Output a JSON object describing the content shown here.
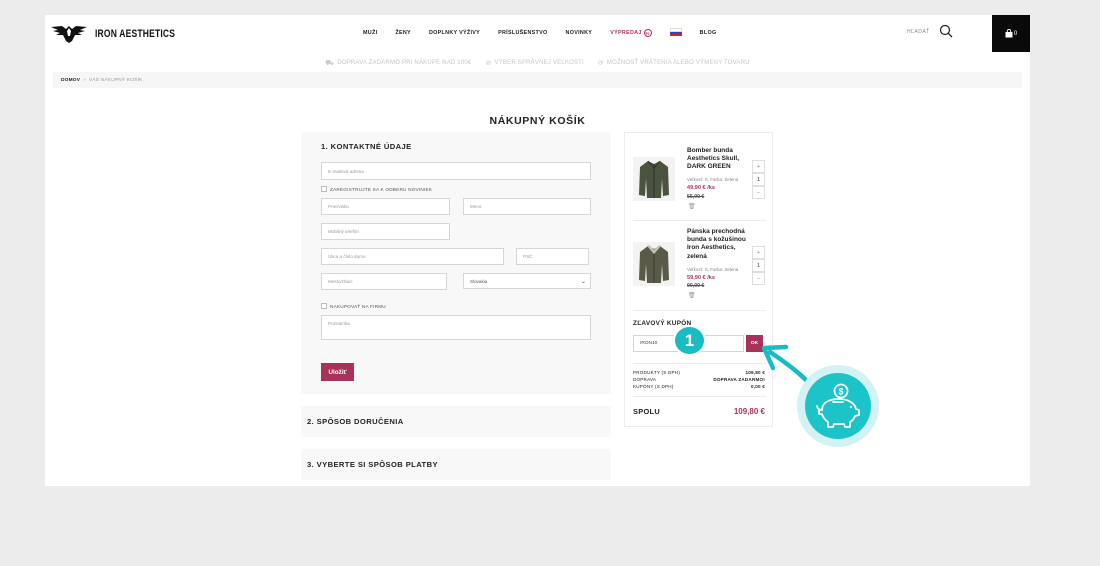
{
  "header": {
    "logo_text": "IRON AESTHETICS",
    "nav": [
      {
        "label": "MUŽI"
      },
      {
        "label": "ŽENY"
      },
      {
        "label": "DOPLNKY VÝŽIVY"
      },
      {
        "label": "PRÍSLUŠENSTVO"
      },
      {
        "label": "NOVINKY"
      },
      {
        "label": "VÝPREDAJ",
        "badge": "%",
        "color": "#b03358"
      }
    ],
    "blog_label": "BLOG",
    "search_label": "HĽADAŤ",
    "cart_count": "0"
  },
  "usp": [
    {
      "icon": "truck-icon",
      "text": "DOPRAVA ZADARMO PRI NÁKUPE NAD 100€"
    },
    {
      "icon": "ruler-icon",
      "text": "VÝBER SPRÁVNEJ VEĽKOSTI"
    },
    {
      "icon": "return-icon",
      "text": "MOŽNOSŤ VRÁTENIA ALEBO VÝMENY TOVARU"
    }
  ],
  "breadcrumb": {
    "home": "DOMOV",
    "sep": "»",
    "current": "VÁŠ NÁKUPNÝ KOŠÍK"
  },
  "page_title": "NÁKUPNÝ KOŠÍK",
  "contact_form": {
    "title": "1. KONTAKTNÉ ÚDAJE",
    "email_placeholder": "E-mailová adresa",
    "newsletter_label": "ZAREGISTRUJTE SA K ODBERU NOVINIEK",
    "surname_placeholder": "Priezvisko",
    "name_placeholder": "Meno",
    "phone_placeholder": "Mobilný telefón",
    "street_placeholder": "Ulica a číslo domu",
    "zip_placeholder": "PSČ",
    "city_placeholder": "Mesto/Obec",
    "country_value": "Slovakia",
    "company_label": "NAKUPOVAŤ NA FIRMU",
    "note_placeholder": "Poznámka",
    "save_label": "Uložiť"
  },
  "steps": {
    "delivery": "2. SPÔSOB DORUČENIA",
    "payment": "3. VYBERTE SI SPÔSOB PLATBY"
  },
  "cart": {
    "items": [
      {
        "name": "Bomber bunda Aesthetics Skull, DARK GREEN",
        "meta": "Veľkosť: S, Farba: Zelená",
        "price": "49,90 € /ks",
        "old_price": "55,00 €",
        "qty": "1"
      },
      {
        "name": "Pánska prechodná bunda s kožušinou Iron Aesthetics, zelená",
        "meta": "Veľkosť: S, Farba: Zelená",
        "price": "59,90 € /ks",
        "old_price": "90,00 €",
        "qty": "1"
      }
    ],
    "coupon_title": "ZĽAVOVÝ KUPÓN",
    "coupon_value": "IRON10",
    "coupon_ok": "OK",
    "summary": [
      {
        "label": "PRODUKTY (S DPH)",
        "value": "109,80 €"
      },
      {
        "label": "DOPRAVA",
        "value": "DOPRAVA ZADARMO!"
      },
      {
        "label": "KUPÓNY (S DPH)",
        "value": "0,00 €"
      }
    ],
    "total_label": "SPOLU",
    "total_value": "109,80 €"
  },
  "overlay": {
    "step_number": "1",
    "accent_color": "#19bcc2",
    "illustration_icon": "piggy-bank-icon"
  },
  "colors": {
    "brand_accent": "#a8325a",
    "background": "#ececec"
  }
}
